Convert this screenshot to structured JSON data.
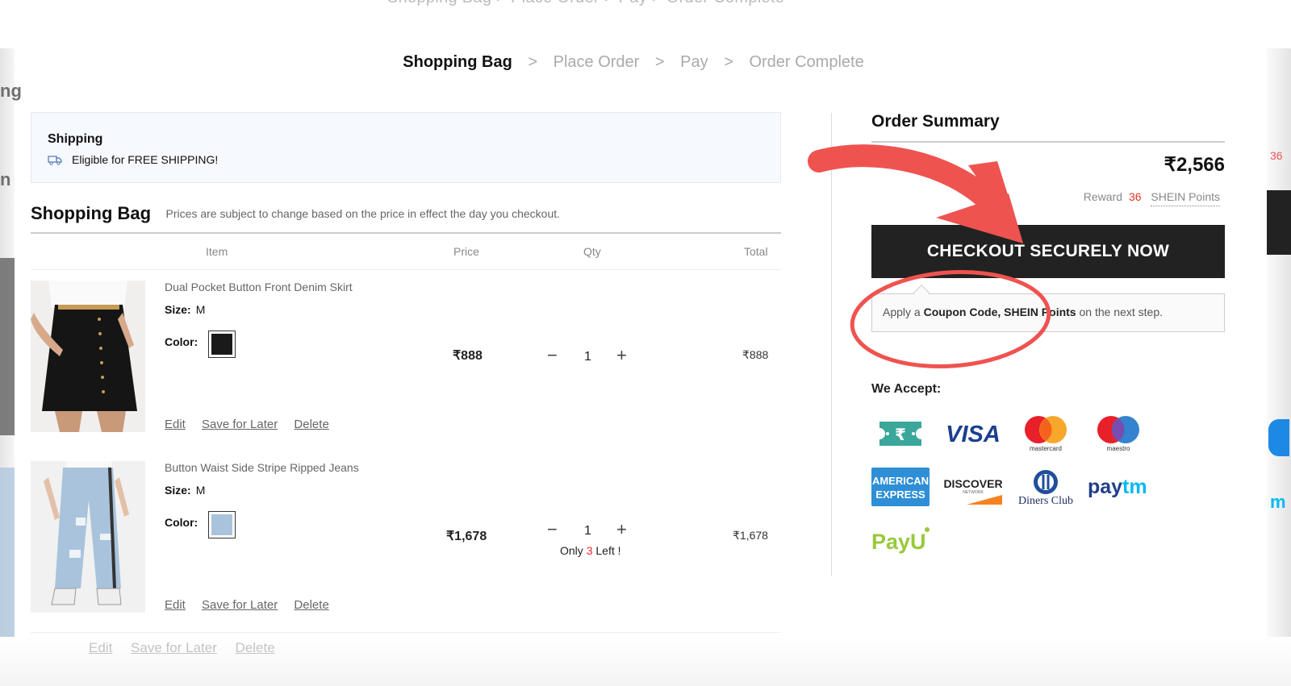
{
  "breadcrumb": {
    "steps": [
      "Shopping Bag",
      "Place Order",
      "Pay",
      "Order Complete"
    ],
    "separator": ">"
  },
  "ghost": {
    "top_text": "Shopping Bag  >  Place Order  >  Pay  >  Order Complete",
    "bottom_links": [
      "Edit",
      "Save for Later",
      "Delete"
    ]
  },
  "shipping": {
    "title": "Shipping",
    "message": "Eligible for FREE SHIPPING!"
  },
  "bag": {
    "title": "Shopping Bag",
    "note": "Prices are subject to change based on the price in effect the day you checkout.",
    "columns": {
      "item": "Item",
      "price": "Price",
      "qty": "Qty",
      "total": "Total"
    },
    "items": [
      {
        "name": "Dual Pocket Button Front Denim Skirt",
        "size_label": "Size:",
        "size": "M",
        "color_label": "Color:",
        "color_hex": "#1a1a1a",
        "price": "₹888",
        "qty": "1",
        "total": "₹888",
        "actions": [
          "Edit",
          "Save for Later",
          "Delete"
        ]
      },
      {
        "name": "Button Waist Side Stripe Ripped Jeans",
        "size_label": "Size:",
        "size": "M",
        "color_label": "Color:",
        "color_hex": "#a9c3dc",
        "price": "₹1,678",
        "qty": "1",
        "total": "₹1,678",
        "stock_prefix": "Only",
        "stock_count": "3",
        "stock_suffix": "Left !",
        "actions": [
          "Edit",
          "Save for Later",
          "Delete"
        ]
      }
    ]
  },
  "summary": {
    "title": "Order Summary",
    "total": "₹2,566",
    "reward_prefix": "Reward",
    "reward_points": "36",
    "reward_suffix": "SHEIN Points",
    "checkout_label": "CHECKOUT SECURELY NOW",
    "coupon_prefix": "Apply a",
    "coupon_bold": "Coupon Code, SHEIN Points",
    "coupon_suffix": "on the next step.",
    "accept_label": "We Accept:",
    "payment_methods": [
      "Cash on Delivery",
      "VISA",
      "mastercard",
      "maestro",
      "AMERICAN EXPRESS",
      "DISCOVER",
      "Diners Club",
      "Paytm",
      "PayU"
    ]
  },
  "colors": {
    "accent_annotation": "#ef5350",
    "checkout_bg": "#222222",
    "stock_red": "#e22222"
  }
}
